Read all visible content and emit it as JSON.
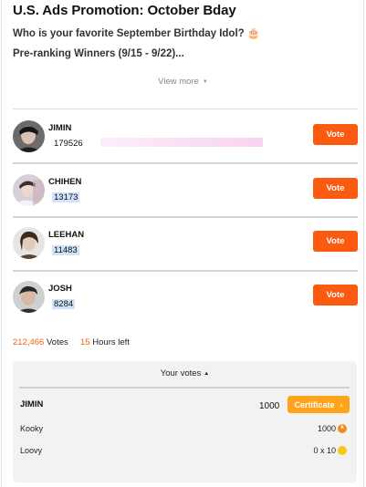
{
  "header": {
    "title": "U.S. Ads Promotion: October Bday",
    "subtitle": "Who is your favorite September Birthday Idol?",
    "subtitle_emoji": "🎂",
    "preranking": "Pre-ranking Winners (9/15 - 9/22)...",
    "view_more": "View more"
  },
  "candidates": [
    {
      "name": "JIMIN",
      "votes": "179526"
    },
    {
      "name": "CHIHEN",
      "votes": "13173"
    },
    {
      "name": "LEEHAN",
      "votes": "11483"
    },
    {
      "name": "JOSH",
      "votes": "8284"
    }
  ],
  "vote_label": "Vote",
  "totals": {
    "votes_number": "212,466",
    "votes_label": "Votes",
    "hours_number": "15",
    "hours_label": "Hours left"
  },
  "your_votes": {
    "title": "Your votes",
    "voted_for": "JIMIN",
    "count": "1000",
    "certificate_label": "Certificate",
    "currencies": [
      {
        "label": "Kooky",
        "value": "1000",
        "coin_letter": "k"
      },
      {
        "label": "Loovy",
        "value": "0 x 10",
        "coin_letter": ""
      }
    ]
  },
  "colors": {
    "vote_button": "#fb5a10",
    "certificate_button": "#ffa41b",
    "accent_number": "#f26516",
    "kooky_coin": "#f58a1f",
    "loovy_coin": "#f4cc16"
  }
}
